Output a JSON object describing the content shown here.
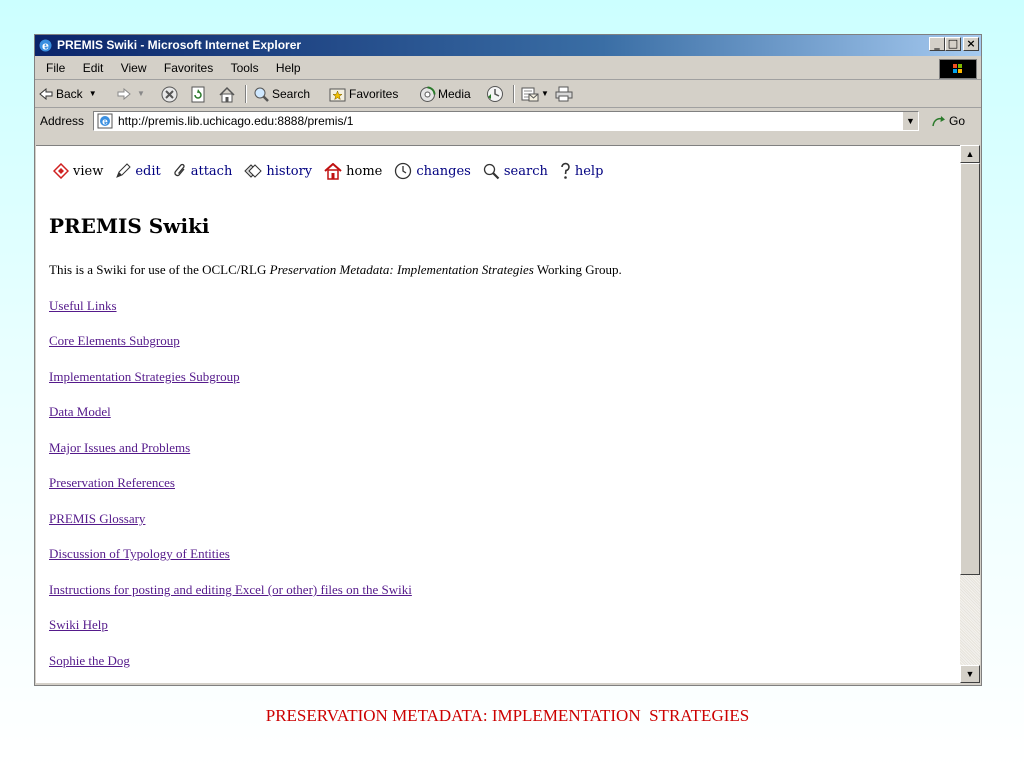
{
  "window": {
    "title": "PREMIS Swiki - Microsoft Internet Explorer",
    "minimize_label": "_",
    "maximize_label": "□",
    "close_label": "×"
  },
  "menu": [
    "File",
    "Edit",
    "View",
    "Favorites",
    "Tools",
    "Help"
  ],
  "toolbar": {
    "back": "Back",
    "search": "Search",
    "favorites": "Favorites",
    "media": "Media"
  },
  "address": {
    "label": "Address",
    "url": "http://premis.lib.uchicago.edu:8888/premis/1",
    "go": "Go"
  },
  "swiki_nav": [
    {
      "label": "view",
      "icon": "view-icon"
    },
    {
      "label": "edit",
      "icon": "edit-icon"
    },
    {
      "label": "attach",
      "icon": "attach-icon"
    },
    {
      "label": "history",
      "icon": "history-icon"
    },
    {
      "label": "home",
      "icon": "home-icon"
    },
    {
      "label": "changes",
      "icon": "clock-icon"
    },
    {
      "label": "search",
      "icon": "magnifier-icon"
    },
    {
      "label": "help",
      "icon": "question-icon"
    }
  ],
  "page": {
    "title": "PREMIS Swiki",
    "intro_before": "This is a Swiki for use of the OCLC/RLG ",
    "intro_italic": "Preservation Metadata: Implementation Strategies",
    "intro_after": " Working Group."
  },
  "links": [
    "Useful Links",
    "Core Elements Subgroup",
    "Implementation Strategies Subgroup",
    "Data Model",
    "Major Issues and Problems",
    "Preservation References",
    "PREMIS Glossary",
    "Discussion of Typology of Entities",
    "Instructions for posting and editing Excel (or other) files on the Swiki",
    "Swiki Help",
    "Sophie the Dog"
  ],
  "footer": "PRESERVATION METADATA: IMPLEMENTATION  STRATEGIES",
  "colors": {
    "visited_link": "#551a8b",
    "nav_link": "#000080",
    "footer": "#cc0000",
    "title_bar": "#0a246a"
  }
}
